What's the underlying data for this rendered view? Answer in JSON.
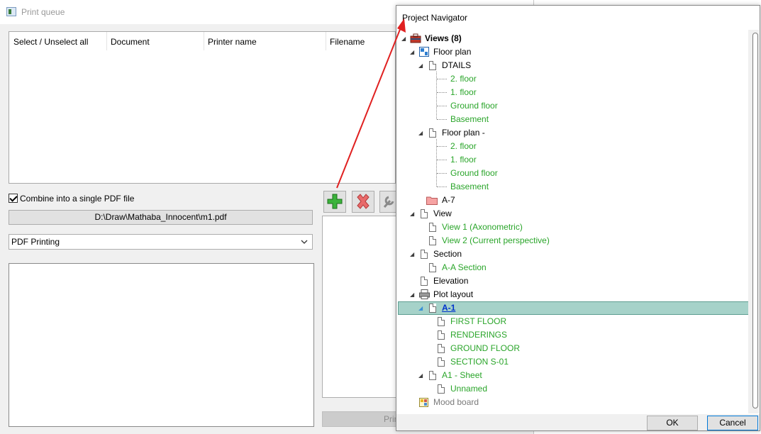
{
  "print_queue": {
    "title": "Print queue",
    "columns": [
      "Select / Unselect all",
      "Document",
      "Printer name",
      "Filename"
    ],
    "combine_label": "Combine into a single PDF file",
    "combine_checked": true,
    "output_path": "D:\\Draw\\Mathaba_Innocent\\m1.pdf",
    "printer_selected": "PDF Printing",
    "print_label": "Print",
    "toolbar_icons": [
      "add-icon",
      "delete-icon",
      "wrench-icon"
    ]
  },
  "navigator": {
    "title": "Project Navigator",
    "root_label": "Views (8)",
    "floor_plan": {
      "label": "Floor plan",
      "dtails": {
        "label": "DTAILS",
        "children": [
          "2. floor",
          "1. floor",
          "Ground floor",
          "Basement"
        ]
      },
      "floor_plan_dash": {
        "label": "Floor plan -",
        "children": [
          "2. floor",
          "1. floor",
          "Ground floor",
          "Basement"
        ]
      },
      "a7": "A-7"
    },
    "view": {
      "label": "View",
      "children": [
        "View 1 (Axonometric)",
        "View 2 (Current perspective)"
      ]
    },
    "section": {
      "label": "Section",
      "children": [
        "A-A Section"
      ]
    },
    "elevation": "Elevation",
    "plot_layout": {
      "label": "Plot layout",
      "a1": {
        "label": "A-1",
        "children": [
          "FIRST FLOOR",
          "RENDERINGS",
          "GROUND FLOOR",
          "SECTION S-01"
        ]
      },
      "a1_sheet": {
        "label": "A1 - Sheet",
        "children": [
          "Unnamed"
        ]
      }
    },
    "mood_board": "Mood board",
    "ok_label": "OK",
    "cancel_label": "Cancel"
  },
  "colors": {
    "arrow": "#e02020",
    "selected_row": "#a6d2c9",
    "child_text": "#2aa52a",
    "link": "#0033cc"
  }
}
